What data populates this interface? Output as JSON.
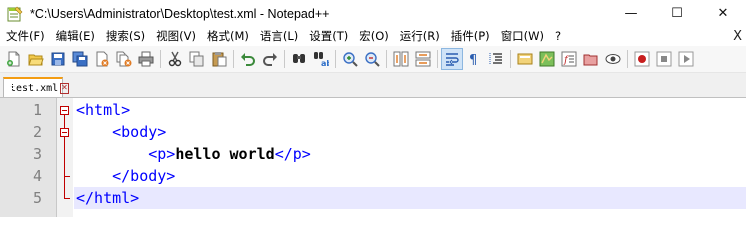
{
  "window": {
    "title": "*C:\\Users\\Administrator\\Desktop\\test.xml - Notepad++",
    "controls": {
      "minimize": "—",
      "maximize": "☐",
      "close": "✕"
    }
  },
  "menu": {
    "items": [
      "文件(F)",
      "编辑(E)",
      "搜索(S)",
      "视图(V)",
      "格式(M)",
      "语言(L)",
      "设置(T)",
      "宏(O)",
      "运行(R)",
      "插件(P)",
      "窗口(W)",
      "?"
    ],
    "close": "X"
  },
  "toolbar": {
    "icons": [
      "new-file-icon",
      "open-file-icon",
      "save-icon",
      "save-all-icon",
      "close-icon",
      "close-all-icon",
      "print-icon",
      "cut-icon",
      "copy-icon",
      "paste-icon",
      "undo-icon",
      "redo-icon",
      "find-icon",
      "replace-icon",
      "zoom-in-icon",
      "zoom-out-icon",
      "sync-vertical-icon",
      "sync-horizontal-icon",
      "word-wrap-icon",
      "show-all-characters-icon",
      "indent-guide-icon",
      "user-defined-language-icon",
      "document-map-icon",
      "function-list-icon",
      "folder-as-workspace-icon",
      "monitoring-icon",
      "record-macro-icon",
      "stop-recording-icon",
      "playback-macro-icon"
    ]
  },
  "tab": {
    "label": "test.xml",
    "close": "✕"
  },
  "editor": {
    "lines": [
      {
        "number": "1",
        "segments": [
          {
            "t": "<html>",
            "k": "tag"
          }
        ]
      },
      {
        "number": "2",
        "segments": [
          {
            "t": "    ",
            "k": "ws"
          },
          {
            "t": "<body>",
            "k": "tag"
          }
        ]
      },
      {
        "number": "3",
        "segments": [
          {
            "t": "        ",
            "k": "ws"
          },
          {
            "t": "<p>",
            "k": "tag"
          },
          {
            "t": "hello world",
            "k": "text"
          },
          {
            "t": "</p>",
            "k": "tag"
          }
        ]
      },
      {
        "number": "4",
        "segments": [
          {
            "t": "    ",
            "k": "ws"
          },
          {
            "t": "</body>",
            "k": "tag"
          }
        ]
      },
      {
        "number": "5",
        "segments": [
          {
            "t": "</html>",
            "k": "tag"
          }
        ]
      }
    ],
    "current_line": 5
  },
  "colors": {
    "tag": "#0000ff",
    "text": "#000000",
    "line_number": "#808080",
    "current_line_bg": "#e8e8ff",
    "fold_marker": "#c00000",
    "tab_accent": "#f39c12"
  }
}
